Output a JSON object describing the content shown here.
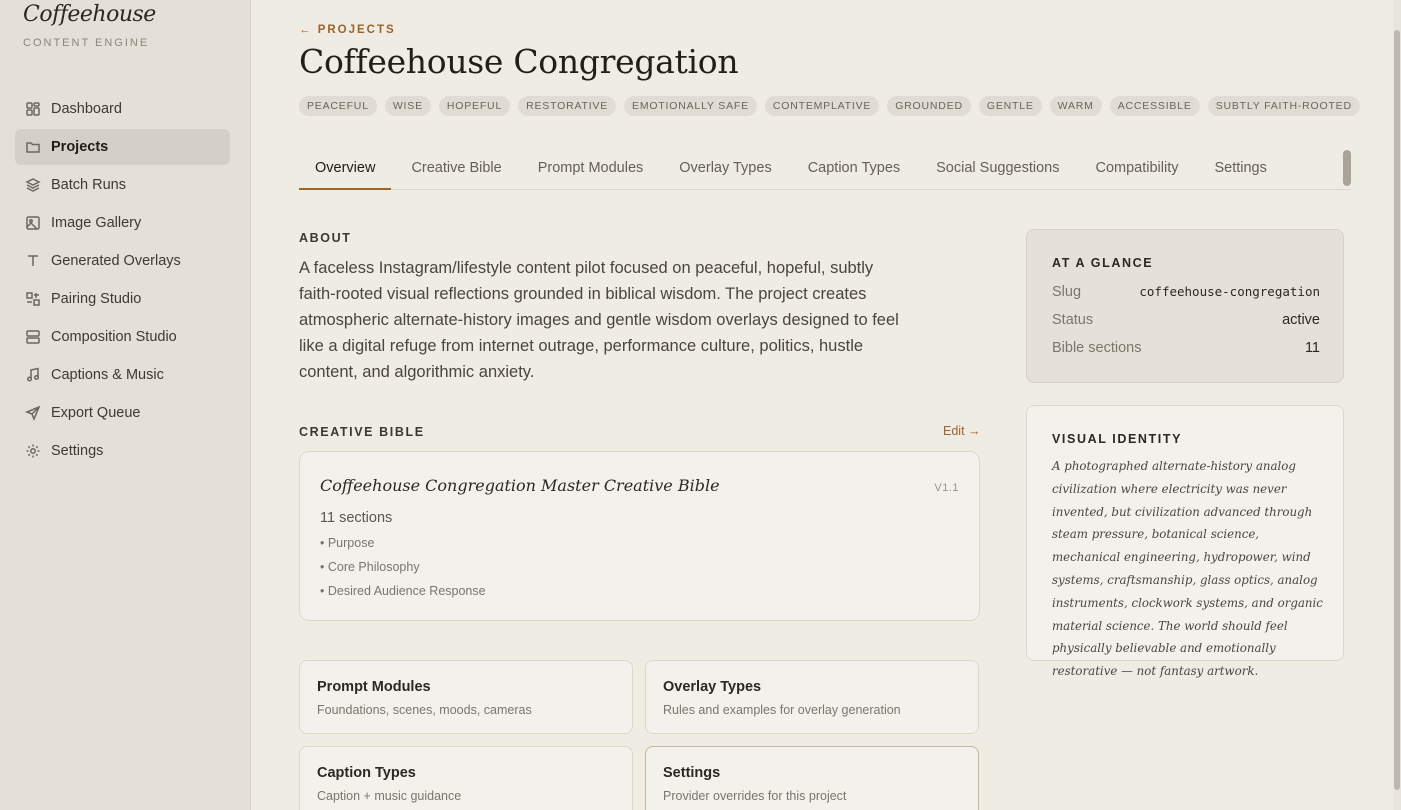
{
  "sidebar": {
    "brand": "Coffeehouse",
    "brand_sub": "CONTENT ENGINE",
    "items": [
      {
        "label": "Dashboard",
        "icon": "grid-icon"
      },
      {
        "label": "Projects",
        "icon": "folder-icon",
        "active": true
      },
      {
        "label": "Batch Runs",
        "icon": "layers-icon"
      },
      {
        "label": "Image Gallery",
        "icon": "image-icon"
      },
      {
        "label": "Generated Overlays",
        "icon": "type-icon"
      },
      {
        "label": "Pairing Studio",
        "icon": "pair-icon"
      },
      {
        "label": "Composition Studio",
        "icon": "layout-icon"
      },
      {
        "label": "Captions & Music",
        "icon": "music-icon"
      },
      {
        "label": "Export Queue",
        "icon": "send-icon"
      },
      {
        "label": "Settings",
        "icon": "gear-icon"
      }
    ]
  },
  "header": {
    "breadcrumb": "← PROJECTS",
    "title": "Coffeehouse Congregation",
    "tags": [
      "PEACEFUL",
      "WISE",
      "HOPEFUL",
      "RESTORATIVE",
      "EMOTIONALLY SAFE",
      "CONTEMPLATIVE",
      "GROUNDED",
      "GENTLE",
      "WARM",
      "ACCESSIBLE",
      "SUBTLY FAITH-ROOTED"
    ]
  },
  "tabs": [
    "Overview",
    "Creative Bible",
    "Prompt Modules",
    "Overlay Types",
    "Caption Types",
    "Social Suggestions",
    "Compatibility",
    "Settings"
  ],
  "about": {
    "heading": "ABOUT",
    "text": "A faceless Instagram/lifestyle content pilot focused on peaceful, hopeful, subtly faith-rooted visual reflections grounded in biblical wisdom. The project creates atmospheric alternate-history images and gentle wisdom overlays designed to feel like a digital refuge from internet outrage, performance culture, politics, hustle content, and algorithmic anxiety."
  },
  "creative_bible": {
    "heading": "CREATIVE BIBLE",
    "edit_label": "Edit →",
    "title": "Coffeehouse Congregation Master Creative Bible",
    "version": "V1.1",
    "count": "11 sections",
    "sections": [
      "• Purpose",
      "• Core Philosophy",
      "• Desired Audience Response"
    ]
  },
  "cards": [
    {
      "title": "Prompt Modules",
      "sub": "Foundations, scenes, moods, cameras"
    },
    {
      "title": "Overlay Types",
      "sub": "Rules and examples for overlay generation"
    },
    {
      "title": "Caption Types",
      "sub": "Caption + music guidance"
    },
    {
      "title": "Settings",
      "sub": "Provider overrides for this project"
    }
  ],
  "glance": {
    "heading": "AT A GLANCE",
    "rows": [
      {
        "key": "Slug",
        "value": "coffeehouse-congregation"
      },
      {
        "key": "Status",
        "value": "active"
      },
      {
        "key": "Bible sections",
        "value": "11"
      }
    ]
  },
  "visual_identity": {
    "heading": "VISUAL IDENTITY",
    "text": "A photographed alternate-history analog civilization where electricity was never invented, but civilization advanced through steam pressure, botanical science, mechanical engineering, hydropower, wind systems, craftsmanship, glass optics, analog instruments, clockwork systems, and organic material science. The world should feel physically believable and emotionally restorative — not fantasy artwork."
  },
  "colors": {
    "accent": "#a0612c",
    "background": "#efece4",
    "sidebar": "#e4e0d8"
  }
}
